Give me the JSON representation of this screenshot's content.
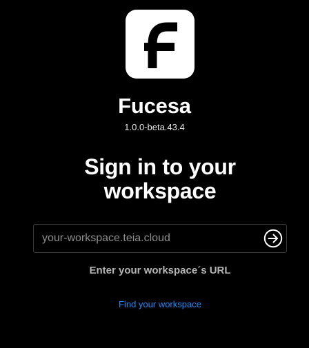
{
  "app": {
    "name": "Fucesa",
    "version": "1.0.0-beta.43.4",
    "logo_icon": "fucesa-logo-icon"
  },
  "signin": {
    "heading_line1": "Sign in to your",
    "heading_line2": "workspace",
    "url_placeholder": "your-workspace.teia.cloud",
    "url_value": "",
    "submit_icon": "arrow-right-circle-icon",
    "hint": "Enter your workspace´s URL",
    "find_link": "Find your workspace"
  },
  "colors": {
    "background": "#000000",
    "text": "#ffffff",
    "muted": "#b5b5b5",
    "link": "#1a8cff",
    "input_border": "#3a3a3a"
  }
}
